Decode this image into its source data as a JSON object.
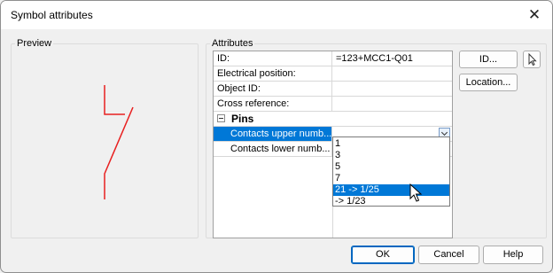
{
  "dialog": {
    "title": "Symbol attributes",
    "close_glyph": "✕"
  },
  "preview": {
    "label": "Preview",
    "symbol_color": "#e82020"
  },
  "attributes": {
    "label": "Attributes",
    "rows": [
      {
        "name": "ID:",
        "value": "=123+MCC1-Q01"
      },
      {
        "name": "Electrical position:",
        "value": ""
      },
      {
        "name": "Object ID:",
        "value": ""
      },
      {
        "name": "Cross reference:",
        "value": ""
      }
    ],
    "category": {
      "name": "Pins",
      "expanded": true
    },
    "pins": [
      {
        "name": "Contacts upper numb...",
        "value": "",
        "selected": true
      },
      {
        "name": "Contacts lower numb...",
        "value": "",
        "selected": false
      }
    ]
  },
  "dropdown": {
    "options": [
      "1",
      "3",
      "5",
      "7",
      "21 -> 1/25",
      "-> 1/23"
    ],
    "highlighted": "21 -> 1/25"
  },
  "side_buttons": {
    "id_label": "ID...",
    "location_label": "Location...",
    "pick_icon": "pointer-icon"
  },
  "footer": {
    "ok_label": "OK",
    "cancel_label": "Cancel",
    "help_label": "Help"
  },
  "colors": {
    "selection": "#0078d7",
    "symbol": "#e82020"
  }
}
